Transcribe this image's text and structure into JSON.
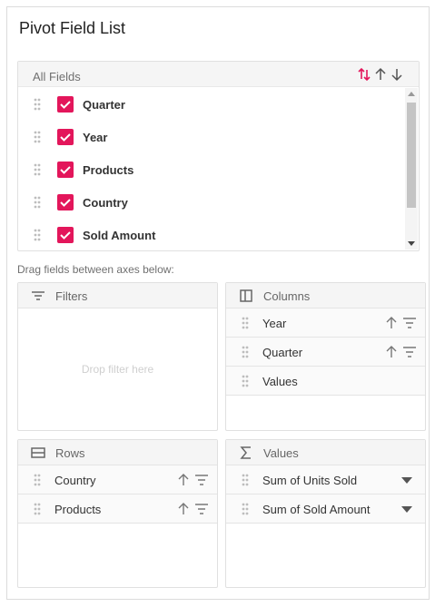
{
  "title": "Pivot Field List",
  "all_fields": {
    "header": "All Fields",
    "items": [
      {
        "label": "Quarter",
        "checked": true
      },
      {
        "label": "Year",
        "checked": true
      },
      {
        "label": "Products",
        "checked": true
      },
      {
        "label": "Country",
        "checked": true
      },
      {
        "label": "Sold Amount",
        "checked": true
      }
    ]
  },
  "drag_hint": "Drag fields between axes below:",
  "filters": {
    "header": "Filters",
    "drop_hint": "Drop filter here",
    "icon": "filter-lines-icon"
  },
  "columns": {
    "header": "Columns",
    "icon": "columns-icon",
    "items": [
      "Year",
      "Quarter",
      "Values"
    ]
  },
  "rows": {
    "header": "Rows",
    "icon": "rows-icon",
    "items": [
      "Country",
      "Products"
    ]
  },
  "values": {
    "header": "Values",
    "icon": "sigma-icon",
    "items": [
      "Sum of Units Sold",
      "Sum of Sold Amount"
    ]
  },
  "colors": {
    "accent": "#e3165b",
    "border": "#e0e0e0",
    "header_bg": "#f5f5f5"
  }
}
